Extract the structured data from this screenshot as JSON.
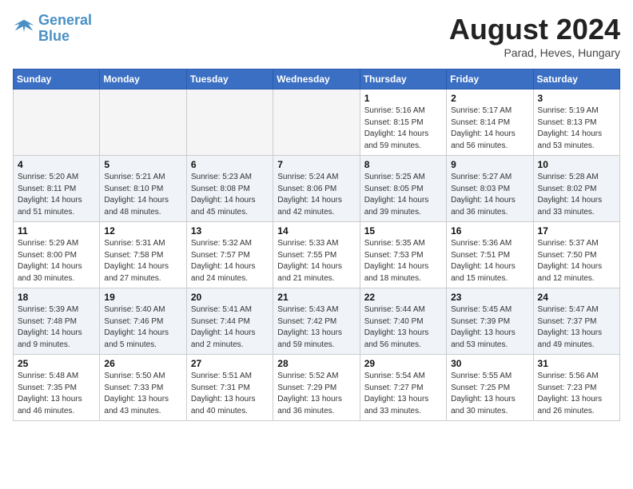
{
  "header": {
    "logo_line1": "General",
    "logo_line2": "Blue",
    "month": "August 2024",
    "location": "Parad, Heves, Hungary"
  },
  "weekdays": [
    "Sunday",
    "Monday",
    "Tuesday",
    "Wednesday",
    "Thursday",
    "Friday",
    "Saturday"
  ],
  "weeks": [
    [
      {
        "day": "",
        "info": ""
      },
      {
        "day": "",
        "info": ""
      },
      {
        "day": "",
        "info": ""
      },
      {
        "day": "",
        "info": ""
      },
      {
        "day": "1",
        "info": "Sunrise: 5:16 AM\nSunset: 8:15 PM\nDaylight: 14 hours\nand 59 minutes."
      },
      {
        "day": "2",
        "info": "Sunrise: 5:17 AM\nSunset: 8:14 PM\nDaylight: 14 hours\nand 56 minutes."
      },
      {
        "day": "3",
        "info": "Sunrise: 5:19 AM\nSunset: 8:13 PM\nDaylight: 14 hours\nand 53 minutes."
      }
    ],
    [
      {
        "day": "4",
        "info": "Sunrise: 5:20 AM\nSunset: 8:11 PM\nDaylight: 14 hours\nand 51 minutes."
      },
      {
        "day": "5",
        "info": "Sunrise: 5:21 AM\nSunset: 8:10 PM\nDaylight: 14 hours\nand 48 minutes."
      },
      {
        "day": "6",
        "info": "Sunrise: 5:23 AM\nSunset: 8:08 PM\nDaylight: 14 hours\nand 45 minutes."
      },
      {
        "day": "7",
        "info": "Sunrise: 5:24 AM\nSunset: 8:06 PM\nDaylight: 14 hours\nand 42 minutes."
      },
      {
        "day": "8",
        "info": "Sunrise: 5:25 AM\nSunset: 8:05 PM\nDaylight: 14 hours\nand 39 minutes."
      },
      {
        "day": "9",
        "info": "Sunrise: 5:27 AM\nSunset: 8:03 PM\nDaylight: 14 hours\nand 36 minutes."
      },
      {
        "day": "10",
        "info": "Sunrise: 5:28 AM\nSunset: 8:02 PM\nDaylight: 14 hours\nand 33 minutes."
      }
    ],
    [
      {
        "day": "11",
        "info": "Sunrise: 5:29 AM\nSunset: 8:00 PM\nDaylight: 14 hours\nand 30 minutes."
      },
      {
        "day": "12",
        "info": "Sunrise: 5:31 AM\nSunset: 7:58 PM\nDaylight: 14 hours\nand 27 minutes."
      },
      {
        "day": "13",
        "info": "Sunrise: 5:32 AM\nSunset: 7:57 PM\nDaylight: 14 hours\nand 24 minutes."
      },
      {
        "day": "14",
        "info": "Sunrise: 5:33 AM\nSunset: 7:55 PM\nDaylight: 14 hours\nand 21 minutes."
      },
      {
        "day": "15",
        "info": "Sunrise: 5:35 AM\nSunset: 7:53 PM\nDaylight: 14 hours\nand 18 minutes."
      },
      {
        "day": "16",
        "info": "Sunrise: 5:36 AM\nSunset: 7:51 PM\nDaylight: 14 hours\nand 15 minutes."
      },
      {
        "day": "17",
        "info": "Sunrise: 5:37 AM\nSunset: 7:50 PM\nDaylight: 14 hours\nand 12 minutes."
      }
    ],
    [
      {
        "day": "18",
        "info": "Sunrise: 5:39 AM\nSunset: 7:48 PM\nDaylight: 14 hours\nand 9 minutes."
      },
      {
        "day": "19",
        "info": "Sunrise: 5:40 AM\nSunset: 7:46 PM\nDaylight: 14 hours\nand 5 minutes."
      },
      {
        "day": "20",
        "info": "Sunrise: 5:41 AM\nSunset: 7:44 PM\nDaylight: 14 hours\nand 2 minutes."
      },
      {
        "day": "21",
        "info": "Sunrise: 5:43 AM\nSunset: 7:42 PM\nDaylight: 13 hours\nand 59 minutes."
      },
      {
        "day": "22",
        "info": "Sunrise: 5:44 AM\nSunset: 7:40 PM\nDaylight: 13 hours\nand 56 minutes."
      },
      {
        "day": "23",
        "info": "Sunrise: 5:45 AM\nSunset: 7:39 PM\nDaylight: 13 hours\nand 53 minutes."
      },
      {
        "day": "24",
        "info": "Sunrise: 5:47 AM\nSunset: 7:37 PM\nDaylight: 13 hours\nand 49 minutes."
      }
    ],
    [
      {
        "day": "25",
        "info": "Sunrise: 5:48 AM\nSunset: 7:35 PM\nDaylight: 13 hours\nand 46 minutes."
      },
      {
        "day": "26",
        "info": "Sunrise: 5:50 AM\nSunset: 7:33 PM\nDaylight: 13 hours\nand 43 minutes."
      },
      {
        "day": "27",
        "info": "Sunrise: 5:51 AM\nSunset: 7:31 PM\nDaylight: 13 hours\nand 40 minutes."
      },
      {
        "day": "28",
        "info": "Sunrise: 5:52 AM\nSunset: 7:29 PM\nDaylight: 13 hours\nand 36 minutes."
      },
      {
        "day": "29",
        "info": "Sunrise: 5:54 AM\nSunset: 7:27 PM\nDaylight: 13 hours\nand 33 minutes."
      },
      {
        "day": "30",
        "info": "Sunrise: 5:55 AM\nSunset: 7:25 PM\nDaylight: 13 hours\nand 30 minutes."
      },
      {
        "day": "31",
        "info": "Sunrise: 5:56 AM\nSunset: 7:23 PM\nDaylight: 13 hours\nand 26 minutes."
      }
    ]
  ]
}
